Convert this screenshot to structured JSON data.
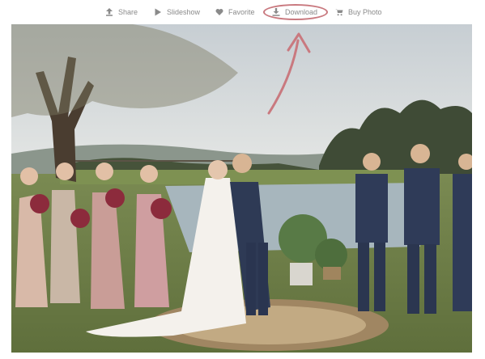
{
  "toolbar": {
    "items": [
      {
        "label": "Share",
        "icon": "share-icon"
      },
      {
        "label": "Slideshow",
        "icon": "play-icon"
      },
      {
        "label": "Favorite",
        "icon": "heart-icon"
      },
      {
        "label": "Download",
        "icon": "download-icon"
      },
      {
        "label": "Buy Photo",
        "icon": "cart-icon"
      }
    ],
    "highlighted": "Download",
    "highlight_color": "#c9797f"
  },
  "photo": {
    "subject": "wedding-ceremony-kiss"
  },
  "colors": {
    "toolbar_text": "#8a8a8a",
    "annotation": "#c9797f"
  }
}
